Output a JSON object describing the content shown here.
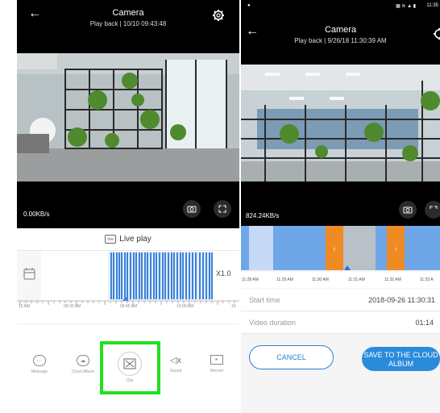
{
  "left": {
    "title": "Camera",
    "subtitle": "Play back | 10/10 09:43:48",
    "speed": "0.00KB/s",
    "live_play": "Live play",
    "live_icon_text": "live",
    "zoom": "X1.0",
    "ticks": [
      "15 AM",
      "09:30 AM",
      "09:45 AM",
      "10:00 AM",
      "10"
    ],
    "nav": [
      "Message",
      "Cloud Album",
      "Clip",
      "Sound",
      "Record"
    ]
  },
  "right": {
    "title": "Camera",
    "subtitle": "Play back | 9/26/18 11:30:39 AM",
    "speed": "824.24KB/s",
    "status_time": "11:35",
    "time_labels": [
      "11:28 AM",
      "11:29 AM",
      "11:30 AM",
      "11:31 AM",
      "11:32 AM",
      "11:33 A"
    ],
    "start_label": "Start time",
    "start_value": "2018-09-26 11:30:31",
    "duration_label": "Video duration",
    "duration_value": "01:14",
    "cancel": "CANCEL",
    "save": "SAVE TO THE CLOUD ALBUM"
  },
  "colors": {
    "accent": "#2b8bdb",
    "clip_blue": "#6fa6e8",
    "clip_orange": "#f08a23",
    "highlight": "#22e022"
  }
}
